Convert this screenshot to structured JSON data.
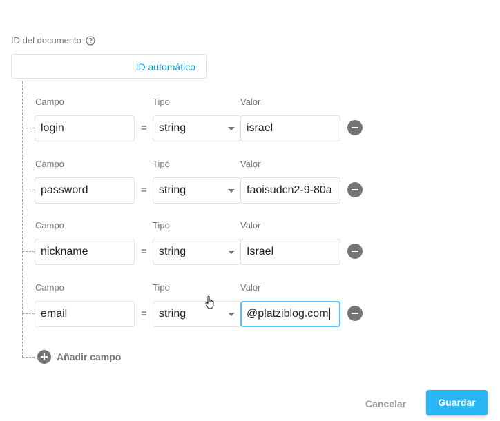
{
  "document_id": {
    "label": "ID del documento",
    "value": "ID automático"
  },
  "column_labels": {
    "field": "Campo",
    "type": "Tipo",
    "value": "Valor"
  },
  "equals_sign": "=",
  "fields": [
    {
      "name": "login",
      "type": "string",
      "value": "israel"
    },
    {
      "name": "password",
      "type": "string",
      "value": "faoisudcn2-9-80a"
    },
    {
      "name": "nickname",
      "type": "string",
      "value": "Israel"
    },
    {
      "name": "email",
      "type": "string",
      "value": "@platziblog.com"
    }
  ],
  "add_field_label": "Añadir campo",
  "footer": {
    "cancel_label": "Cancelar",
    "save_label": "Guardar"
  },
  "colors": {
    "accent": "#29b6f6",
    "link": "#039be5",
    "muted": "#757575"
  }
}
